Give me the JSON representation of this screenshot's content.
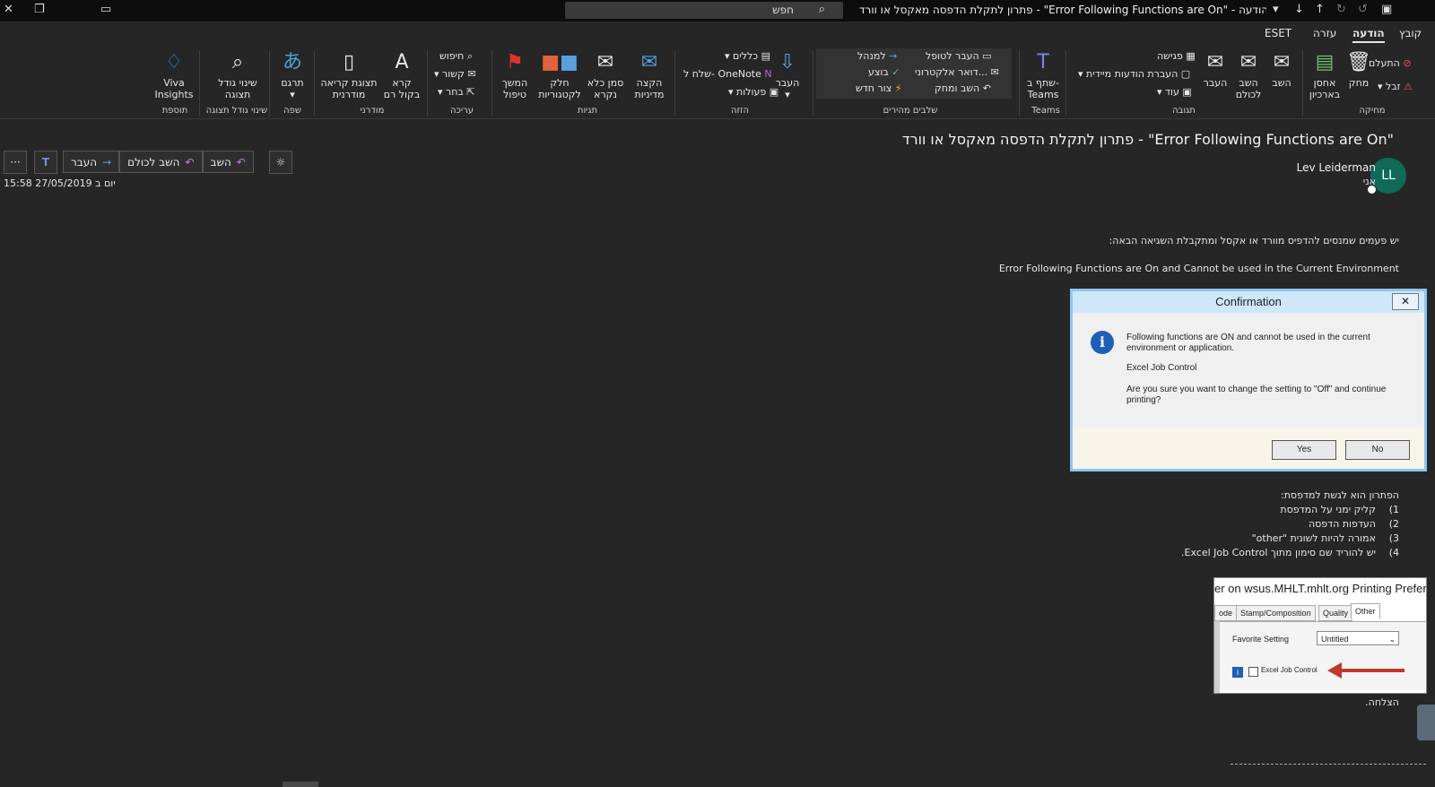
{
  "titlebar": {
    "search_placeholder": "חפש",
    "title": "פתרון לתקלת הדפסה מאקסל או וורד - \"Error Following Functions are On\" - הודעה (HTML)"
  },
  "menu": {
    "tabs": [
      "קובץ",
      "הודעה",
      "עזרה",
      "ESET"
    ]
  },
  "ribbon": {
    "groups": [
      "מחיקה",
      "תגובה",
      "Teams",
      "שלבים מהירים",
      "הזזה",
      "תגיות",
      "עריכה",
      "מודרני",
      "שפה",
      "שינוי גודל תצוגה",
      "תוספת"
    ],
    "delete": {
      "ignore": "התעלם",
      "junk": "זבל",
      "delete": "מחק",
      "archive": "אחסן בארכיון"
    },
    "respond": {
      "reply": "השב",
      "reply_all": "השב לכולם",
      "forward": "העבר",
      "meeting": "פגישה",
      "im": "העברת הודעות מיידית",
      "more": "עוד"
    },
    "teams": {
      "share": "שתף ב- Teams"
    },
    "quick_steps": {
      "to_manager": "העבר לטופל",
      "team_email": "דואר אלקטרוני...",
      "reply_delete": "השב ומחק",
      "to_mgr2": "למנהל",
      "done": "בוצע",
      "create_new": "צור חדש"
    },
    "move": {
      "move": "העבר",
      "rules": "כללים",
      "onenote": "שלח ל- OneNote",
      "actions": "פעולות"
    },
    "tags": {
      "assign_policy": "הקצה מדיניות",
      "mark_unread": "סמן כלא נקרא",
      "categorize": "חלק לקטגוריות",
      "follow_up": "המשך טיפול"
    },
    "editing": {
      "find": "חיפוש",
      "related": "קשור",
      "select": "בחר"
    },
    "modern": {
      "read_aloud": "קרא בקול רם",
      "immersive": "תצוגת קריאה מודרנית"
    },
    "language": {
      "translate": "תרגם"
    },
    "zoom": {
      "zoom": "שינוי גודל תצוגה"
    },
    "addins": {
      "viva": "Viva Insights"
    }
  },
  "message": {
    "subject": "פתרון לתקלת הדפסה מאקסל או וורד - \"Error Following Functions are On\"",
    "sender": "Lev Leiderman",
    "recipient": "אני",
    "avatar_initials": "LL",
    "date": "יום ב 27/05/2019 15:58",
    "actions": {
      "reply": "השב",
      "reply_all": "השב לכולם",
      "forward": "העבר"
    }
  },
  "body": {
    "intro": "יש פעמים שמנסים להדפיס מוורד או אקסל ומתקבלת השגיאה הבאה:",
    "error": "Error Following Functions are On and Cannot be used in the Current Environment",
    "solution": "הפתרון הוא לגשת למדפסת:",
    "steps": [
      {
        "n": "1)",
        "text": "קליק ימני על המדפסת"
      },
      {
        "n": "2)",
        "text": "העדפות הדפסה"
      },
      {
        "n": "3)",
        "text": "אמורה להיות לשונית \"other\""
      },
      {
        "n": "4)",
        "text": "יש להוריד שם סימון מתוך Excel Job Control."
      }
    ],
    "closing": "הצלחה."
  },
  "dialog": {
    "title": "Confirmation",
    "line1": "Following functions are ON and cannot be used in the current environment or application.",
    "line2": "Excel Job Control",
    "line3": "Are you sure you want to change the setting to \"Off\" and continue printing?",
    "yes": "Yes",
    "no": "No"
  },
  "prefs": {
    "title": "er on wsus.MHLT.mhlt.org Printing Preferences",
    "tabs": [
      "ode",
      "Stamp/Composition",
      "Quality",
      "Other"
    ],
    "favorite_label": "Favorite Setting",
    "favorite_value": "Untitled",
    "checkbox_label": "Excel Job Control",
    "arrow_color": "#c0392b"
  }
}
